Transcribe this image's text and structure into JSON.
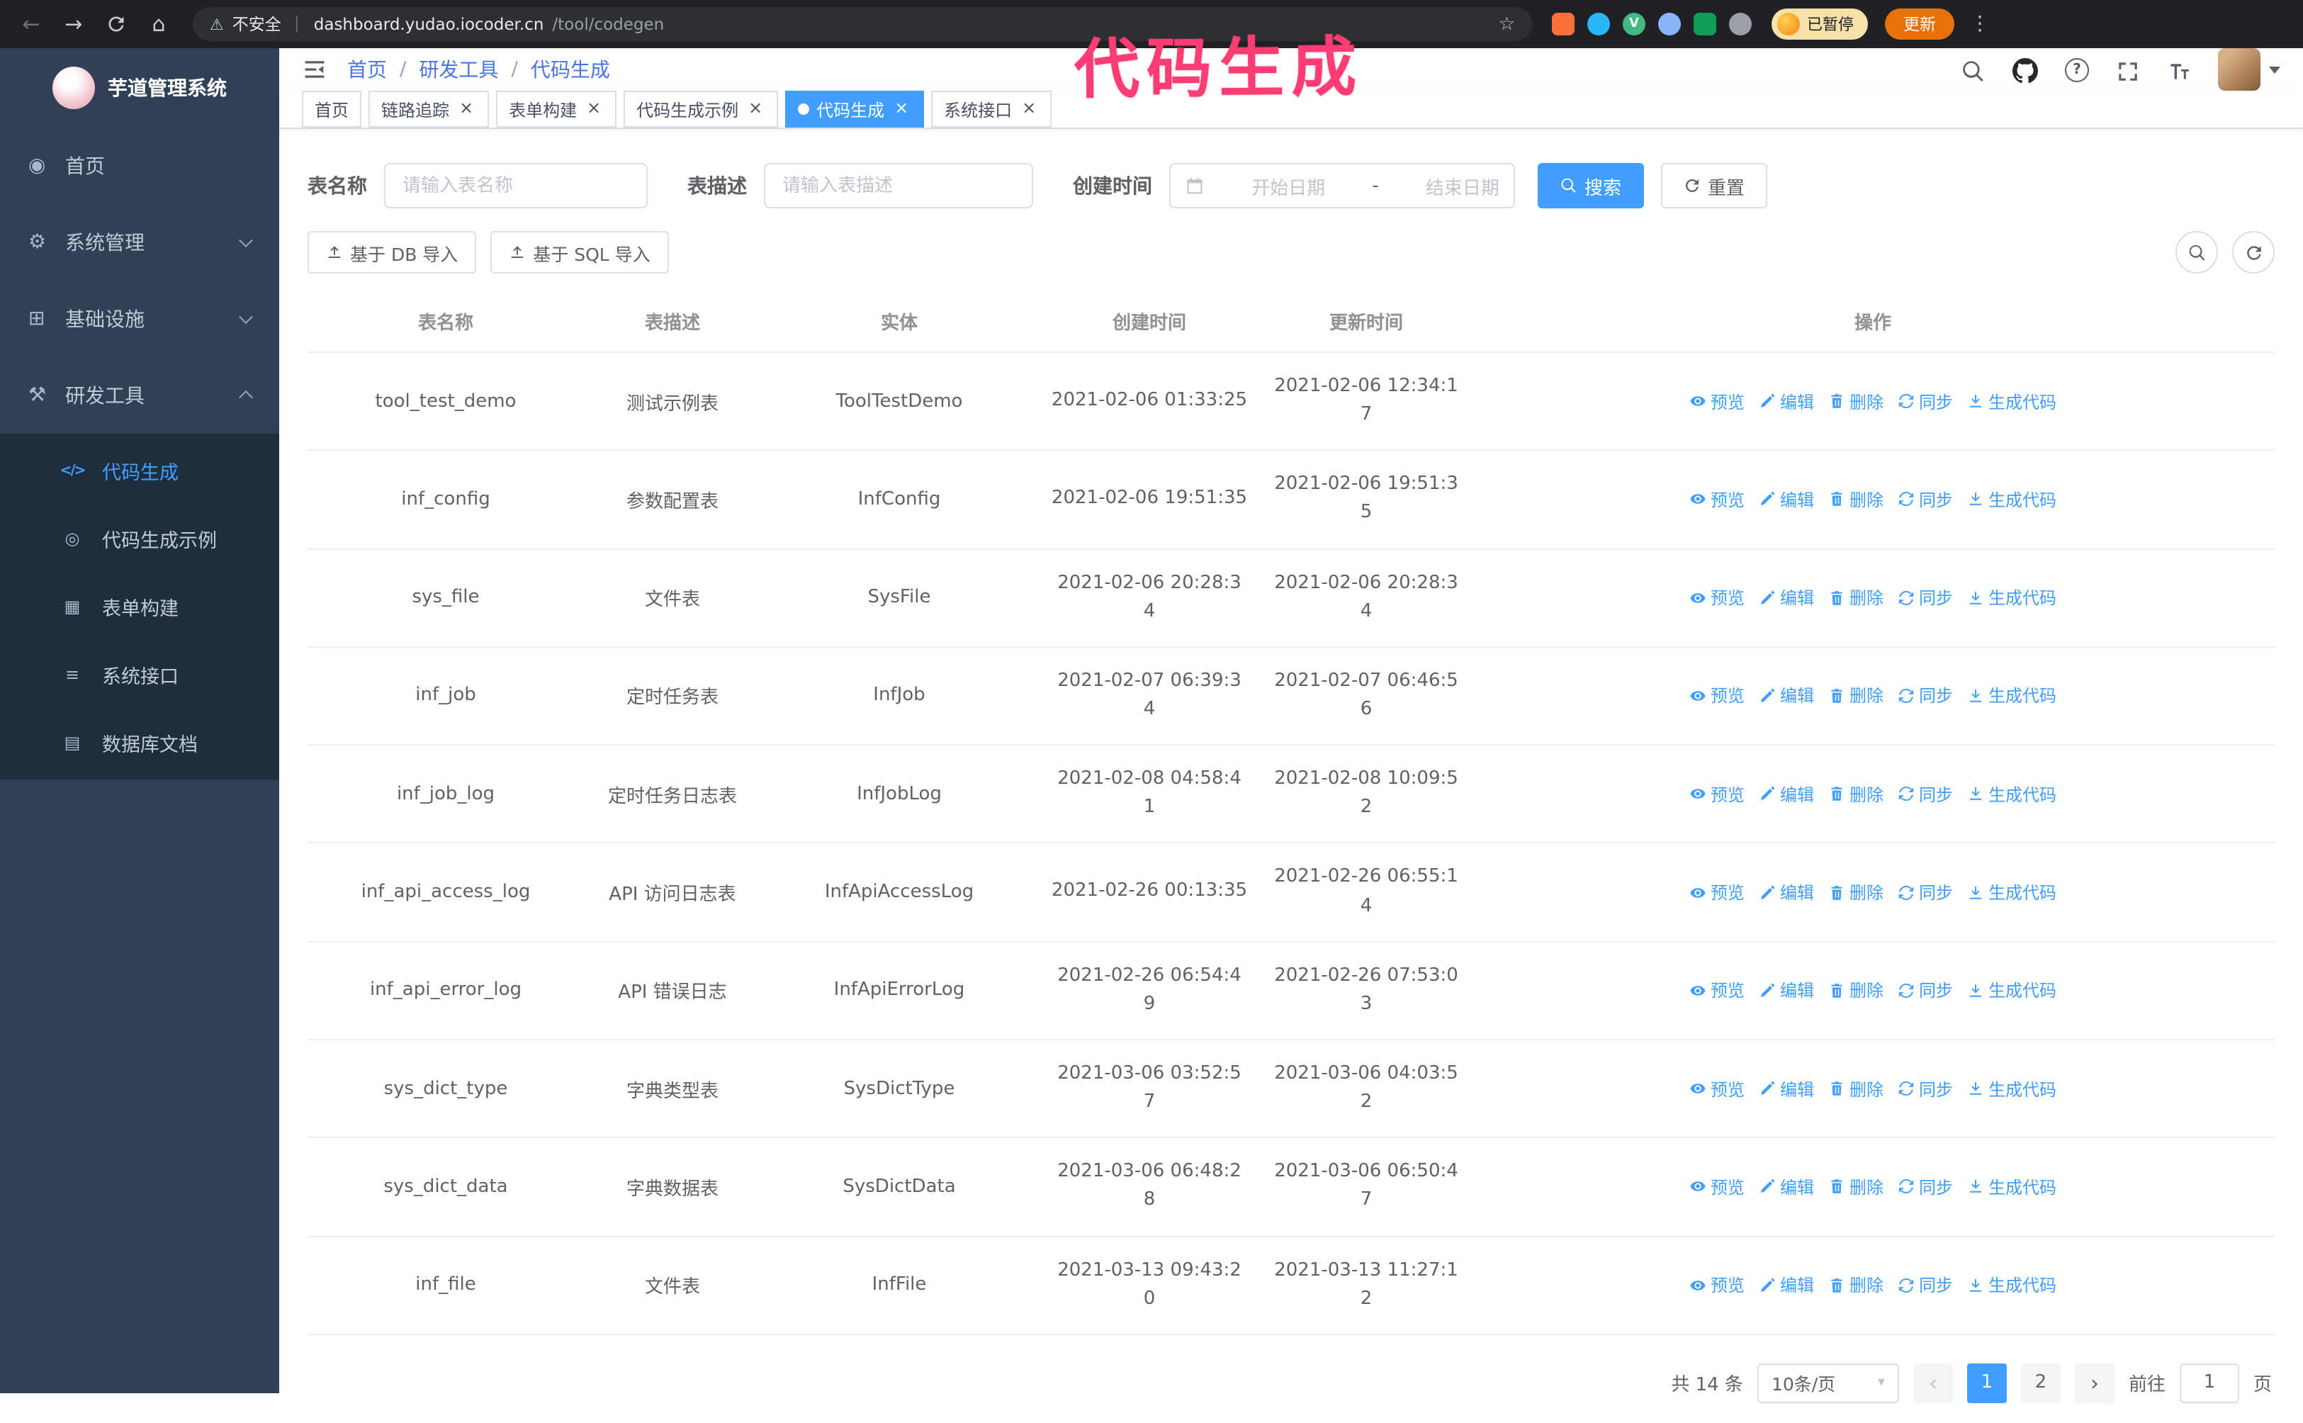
{
  "browser": {
    "security_label": "不安全",
    "url_host": "dashboard.yudao.iocoder.cn",
    "url_path": "/tool/codegen",
    "paused_badge": "已暂停",
    "update_button": "更新"
  },
  "annotation": "代码生成",
  "sidebar": {
    "logo_title": "芋道管理系统",
    "items": [
      {
        "label": "首页",
        "icon": "home-icon"
      },
      {
        "label": "系统管理",
        "icon": "gear-icon",
        "expandable": true
      },
      {
        "label": "基础设施",
        "icon": "infra-icon",
        "expandable": true
      },
      {
        "label": "研发工具",
        "icon": "tools-icon",
        "expanded": true
      }
    ],
    "sub_items": [
      {
        "label": "代码生成",
        "icon": "code-icon",
        "active": true
      },
      {
        "label": "代码生成示例",
        "icon": "example-icon"
      },
      {
        "label": "表单构建",
        "icon": "form-icon"
      },
      {
        "label": "系统接口",
        "icon": "api-icon"
      },
      {
        "label": "数据库文档",
        "icon": "db-doc-icon"
      }
    ]
  },
  "breadcrumb": [
    "首页",
    "研发工具",
    "代码生成"
  ],
  "tabs": [
    {
      "label": "首页",
      "closable": false,
      "active": false
    },
    {
      "label": "链路追踪",
      "closable": true,
      "active": false
    },
    {
      "label": "表单构建",
      "closable": true,
      "active": false
    },
    {
      "label": "代码生成示例",
      "closable": true,
      "active": false
    },
    {
      "label": "代码生成",
      "closable": true,
      "active": true
    },
    {
      "label": "系统接口",
      "closable": true,
      "active": false
    }
  ],
  "filters": {
    "table_name_label": "表名称",
    "table_name_placeholder": "请输入表名称",
    "table_desc_label": "表描述",
    "table_desc_placeholder": "请输入表描述",
    "create_time_label": "创建时间",
    "date_start_placeholder": "开始日期",
    "date_separator": "-",
    "date_end_placeholder": "结束日期",
    "search_button": "搜索",
    "reset_button": "重置"
  },
  "toolbar": {
    "import_db": "基于 DB 导入",
    "import_sql": "基于 SQL 导入"
  },
  "table": {
    "columns": [
      "表名称",
      "表描述",
      "实体",
      "创建时间",
      "更新时间",
      "操作"
    ],
    "actions": [
      "预览",
      "编辑",
      "删除",
      "同步",
      "生成代码"
    ],
    "rows": [
      {
        "name": "tool_test_demo",
        "desc": "测试示例表",
        "entity": "ToolTestDemo",
        "create_time": "2021-02-06 01:33:25",
        "update_time": "2021-02-06 12:34:17"
      },
      {
        "name": "inf_config",
        "desc": "参数配置表",
        "entity": "InfConfig",
        "create_time": "2021-02-06 19:51:35",
        "update_time": "2021-02-06 19:51:35"
      },
      {
        "name": "sys_file",
        "desc": "文件表",
        "entity": "SysFile",
        "create_time": "2021-02-06 20:28:3\n4",
        "update_time": "2021-02-06 20:28:3\n4"
      },
      {
        "name": "inf_job",
        "desc": "定时任务表",
        "entity": "InfJob",
        "create_time": "2021-02-07 06:39:3\n4",
        "update_time": "2021-02-07 06:46:5\n6"
      },
      {
        "name": "inf_job_log",
        "desc": "定时任务日志表",
        "entity": "InfJobLog",
        "create_time": "2021-02-08 04:58:4\n1",
        "update_time": "2021-02-08 10:09:5\n2"
      },
      {
        "name": "inf_api_access_log",
        "desc": "API 访问日志表",
        "entity": "InfApiAccessLog",
        "create_time": "2021-02-26 00:13:35",
        "update_time": "2021-02-26 06:55:1\n4"
      },
      {
        "name": "inf_api_error_log",
        "desc": "API 错误日志",
        "entity": "InfApiErrorLog",
        "create_time": "2021-02-26 06:54:4\n9",
        "update_time": "2021-02-26 07:53:0\n3"
      },
      {
        "name": "sys_dict_type",
        "desc": "字典类型表",
        "entity": "SysDictType",
        "create_time": "2021-03-06 03:52:5\n7",
        "update_time": "2021-03-06 04:03:5\n2"
      },
      {
        "name": "sys_dict_data",
        "desc": "字典数据表",
        "entity": "SysDictData",
        "create_time": "2021-03-06 06:48:2\n8",
        "update_time": "2021-03-06 06:50:4\n7"
      },
      {
        "name": "inf_file",
        "desc": "文件表",
        "entity": "InfFile",
        "create_time": "2021-03-13 09:43:2\n0",
        "update_time": "2021-03-13 11:27:12"
      }
    ]
  },
  "pagination": {
    "total": "共 14 条",
    "page_size": "10条/页",
    "pages": [
      "1",
      "2"
    ],
    "active_page": "1",
    "goto_label": "前往",
    "goto_value": "1",
    "goto_unit": "页"
  },
  "colors": {
    "accent": "#409EFF",
    "sidebar": "#304156",
    "submenu": "#1F2D3D",
    "chrome_bar": "#202124",
    "annotation": "#FB3D74",
    "update_button": "#E8710A"
  }
}
